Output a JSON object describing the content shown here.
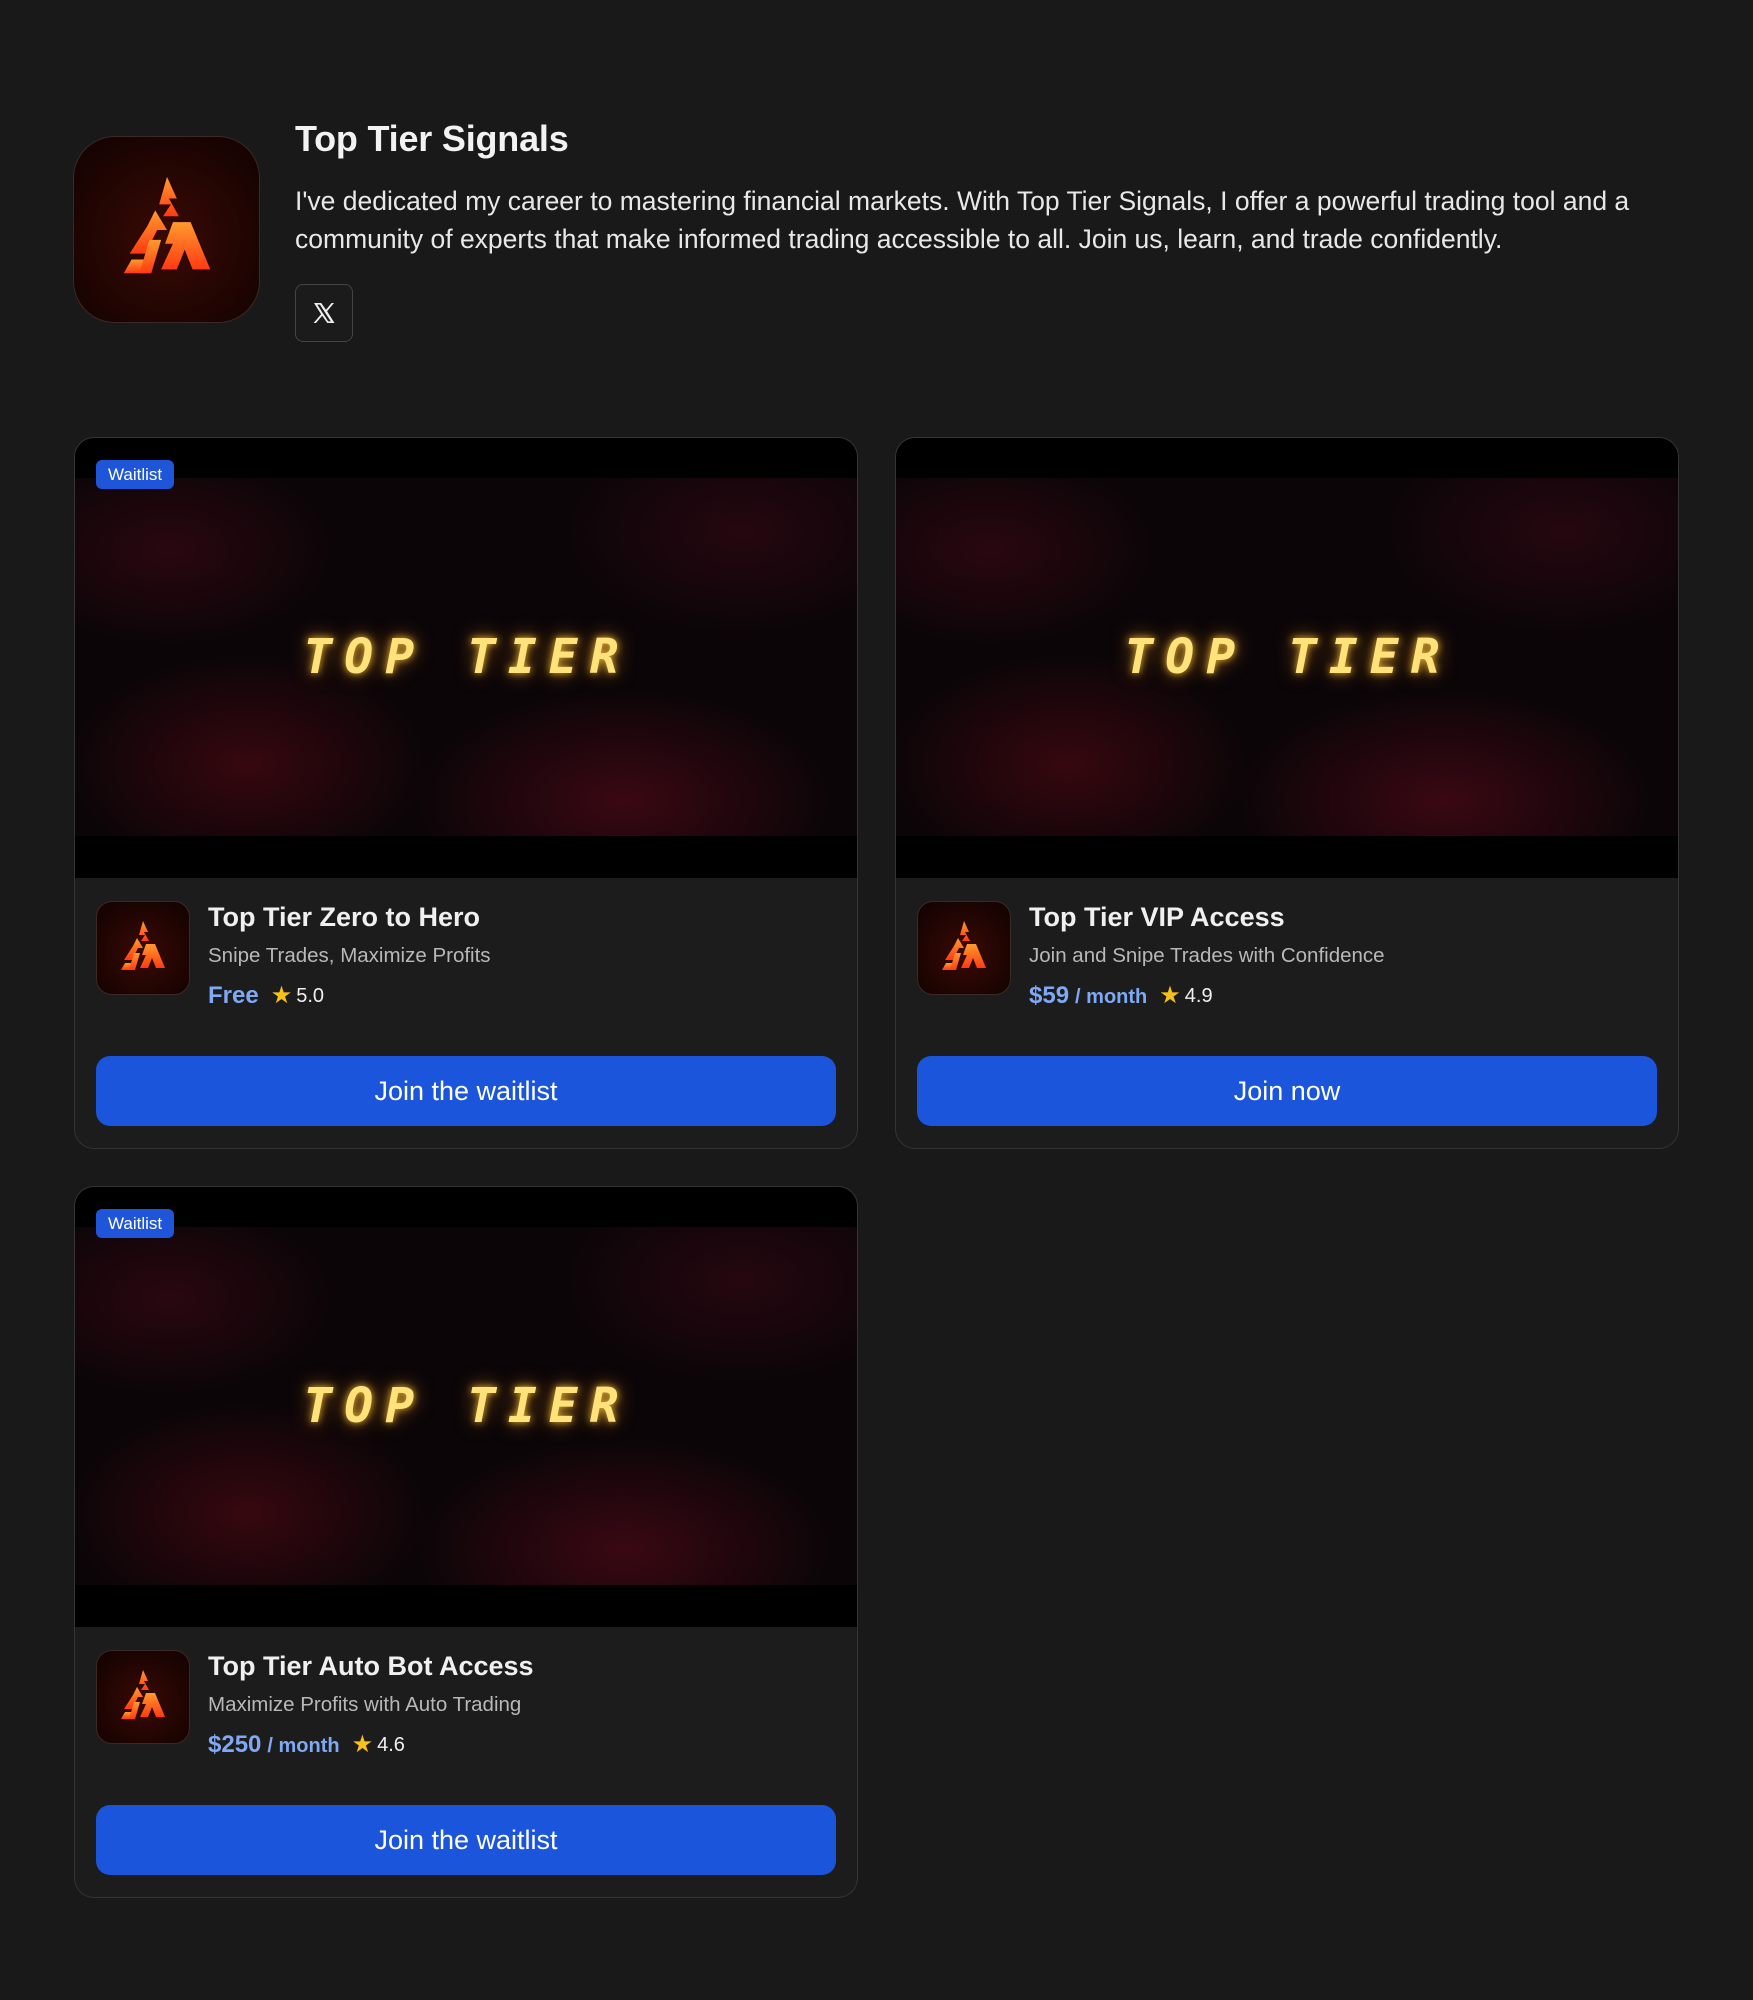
{
  "profile": {
    "title": "Top Tier Signals",
    "bio": "I've dedicated my career to mastering financial markets. With Top Tier Signals, I offer a powerful trading tool and a community of experts that make informed trading accessible to all. Join us, learn, and trade confidently.",
    "social": {
      "icon": "x-logo-icon",
      "glyph": "𝕏"
    },
    "logo_icon": "fire-peak-logo-icon"
  },
  "thumbnail_text": "TOP TIER",
  "products": [
    {
      "badge": "Waitlist",
      "title": "Top Tier Zero to Hero",
      "subtitle": "Snipe Trades, Maximize Profits",
      "price": "Free",
      "period": "",
      "rating": "5.0",
      "cta": "Join the waitlist"
    },
    {
      "badge": "",
      "title": "Top Tier VIP Access",
      "subtitle": "Join and Snipe Trades with Confidence",
      "price": "$59",
      "period": "/ month",
      "rating": "4.9",
      "cta": "Join now"
    },
    {
      "badge": "Waitlist",
      "title": "Top Tier Auto Bot Access",
      "subtitle": "Maximize Profits with Auto Trading",
      "price": "$250",
      "period": "/ month",
      "rating": "4.6",
      "cta": "Join the waitlist"
    }
  ],
  "colors": {
    "background": "#191919",
    "accent": "#1b55db",
    "price": "#7fa8f5",
    "star": "#f6c21a",
    "thumbnail_glow": "#ffe27a"
  }
}
